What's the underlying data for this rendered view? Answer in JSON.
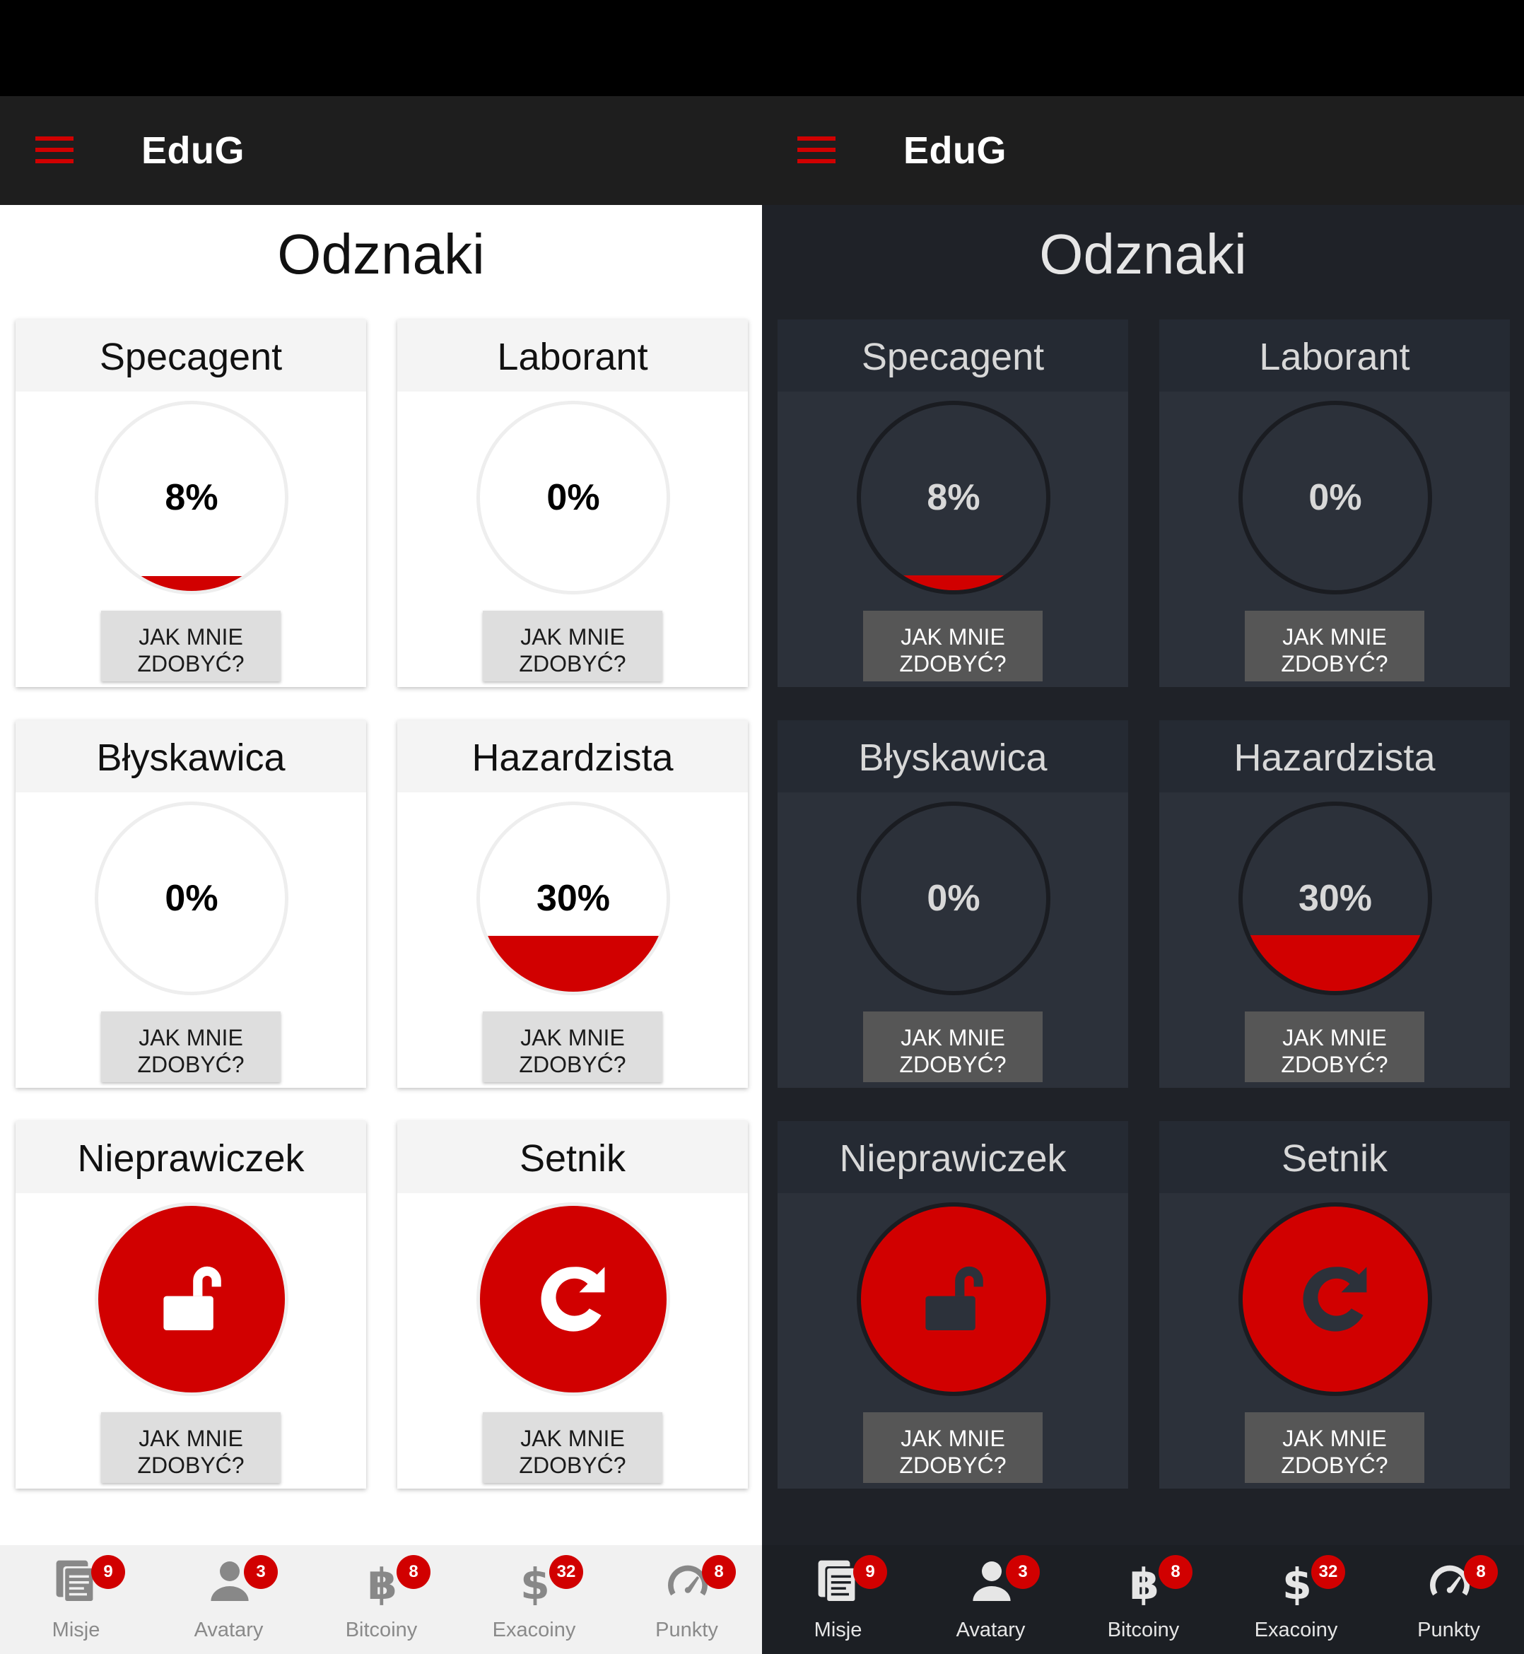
{
  "app": {
    "title": "EduG"
  },
  "page": {
    "title": "Odznaki"
  },
  "badges": [
    {
      "name": "Specagent",
      "type": "progress",
      "progress": 0.08,
      "progress_label": "8%",
      "button": "JAK MNIE ZDOBYĆ?"
    },
    {
      "name": "Laborant",
      "type": "progress",
      "progress": 0.0,
      "progress_label": "0%",
      "button": "JAK MNIE ZDOBYĆ?"
    },
    {
      "name": "Błyskawica",
      "type": "progress",
      "progress": 0.0,
      "progress_label": "0%",
      "button": "JAK MNIE ZDOBYĆ?"
    },
    {
      "name": "Hazardzista",
      "type": "progress",
      "progress": 0.3,
      "progress_label": "30%",
      "button": "JAK MNIE ZDOBYĆ?"
    },
    {
      "name": "Nieprawiczek",
      "type": "icon",
      "icon": "unlock-icon",
      "button": "JAK MNIE ZDOBYĆ?"
    },
    {
      "name": "Setnik",
      "type": "icon",
      "icon": "redo-icon",
      "button": "JAK MNIE ZDOBYĆ?"
    }
  ],
  "nav": [
    {
      "label": "Misje",
      "icon": "missions-icon",
      "badge": "9"
    },
    {
      "label": "Avatary",
      "icon": "avatar-icon",
      "badge": "3"
    },
    {
      "label": "Bitcoiny",
      "icon": "bitcoin-icon",
      "badge": "8"
    },
    {
      "label": "Exacoiny",
      "icon": "dollar-icon",
      "badge": "32"
    },
    {
      "label": "Punkty",
      "icon": "speedometer-icon",
      "badge": "8"
    }
  ],
  "colors": {
    "accent": "#d10000",
    "light_background": "#ffffff",
    "dark_background": "#1f2228",
    "dark_card": "#2c313a",
    "appbar": "#1e1e1e"
  }
}
